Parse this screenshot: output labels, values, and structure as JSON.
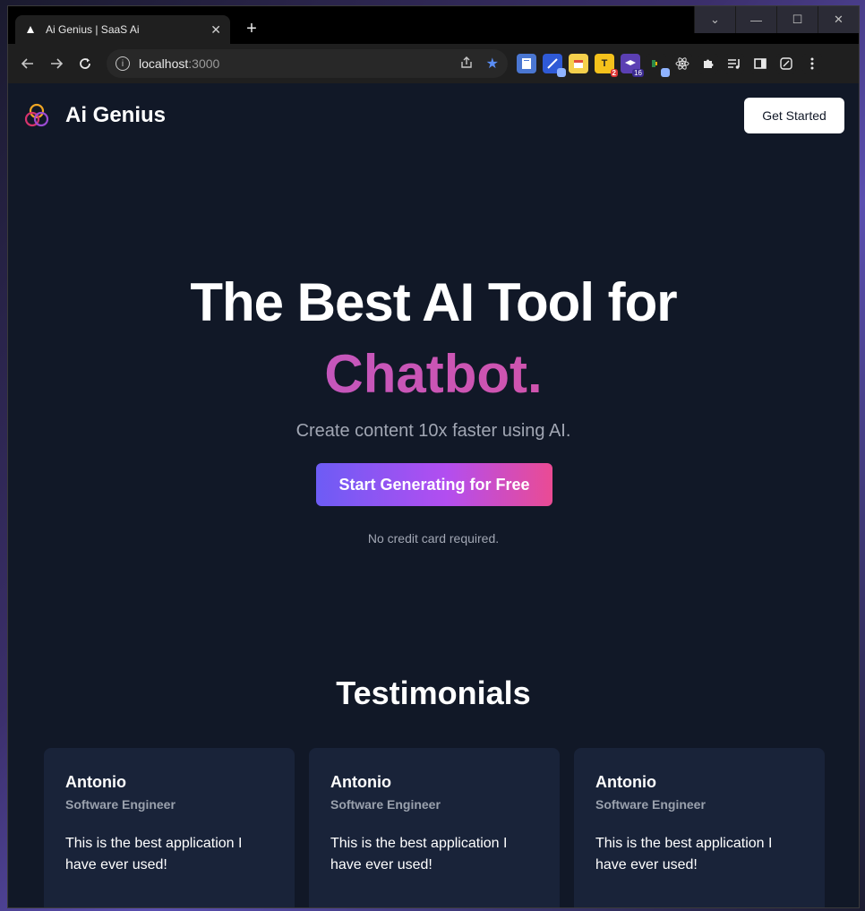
{
  "browser": {
    "tab_title": "Ai Genius | SaaS Ai",
    "tab_close": "✕",
    "new_tab": "+",
    "url_host": "localhost",
    "url_port": ":3000",
    "window_controls": [
      "⌄",
      "—",
      "☐",
      "✕"
    ],
    "extensions": [
      {
        "icon": "document-ext-icon",
        "color": "#4a76d1",
        "badge": ""
      },
      {
        "icon": "compass-ext-icon",
        "color": "#2f5ad6",
        "badge": ""
      },
      {
        "icon": "calendar-ext-icon",
        "color": "#f5d04c",
        "badge": ""
      },
      {
        "icon": "t-ext-icon",
        "color": "#f5c21b",
        "badge": "2"
      },
      {
        "icon": "graduation-ext-icon",
        "color": "#5b3fb3",
        "badge": "16"
      },
      {
        "icon": "meet-ext-icon",
        "color": "#2b8a4a",
        "badge": ""
      },
      {
        "icon": "react-ext-icon",
        "color": "#1f1f1f",
        "badge": ""
      },
      {
        "icon": "puzzle-ext-icon",
        "color": "#1f1f1f",
        "badge": ""
      },
      {
        "icon": "playlist-ext-icon",
        "color": "#1f1f1f",
        "badge": ""
      },
      {
        "icon": "sidepanel-ext-icon",
        "color": "#1f1f1f",
        "badge": ""
      },
      {
        "icon": "edit-ext-icon",
        "color": "#1f1f1f",
        "badge": ""
      },
      {
        "icon": "menu-ext-icon",
        "color": "#1f1f1f",
        "badge": ""
      }
    ]
  },
  "nav": {
    "brand": "Ai Genius",
    "get_started": "Get Started"
  },
  "hero": {
    "title_line1": "The Best AI Tool for",
    "title_line2": "Chatbot.",
    "subtitle": "Create content 10x faster using AI.",
    "cta": "Start Generating for Free",
    "note": "No credit card required."
  },
  "testimonials": {
    "title": "Testimonials",
    "items": [
      {
        "name": "Antonio",
        "role": "Software Engineer",
        "quote": "This is the best application I have ever used!"
      },
      {
        "name": "Antonio",
        "role": "Software Engineer",
        "quote": "This is the best application I have ever used!"
      },
      {
        "name": "Antonio",
        "role": "Software Engineer",
        "quote": "This is the best application I have ever used!"
      }
    ]
  },
  "colors": {
    "background": "#111827",
    "card": "#192339",
    "accent_start": "#6d5cf5",
    "accent_end": "#ea4b94"
  }
}
